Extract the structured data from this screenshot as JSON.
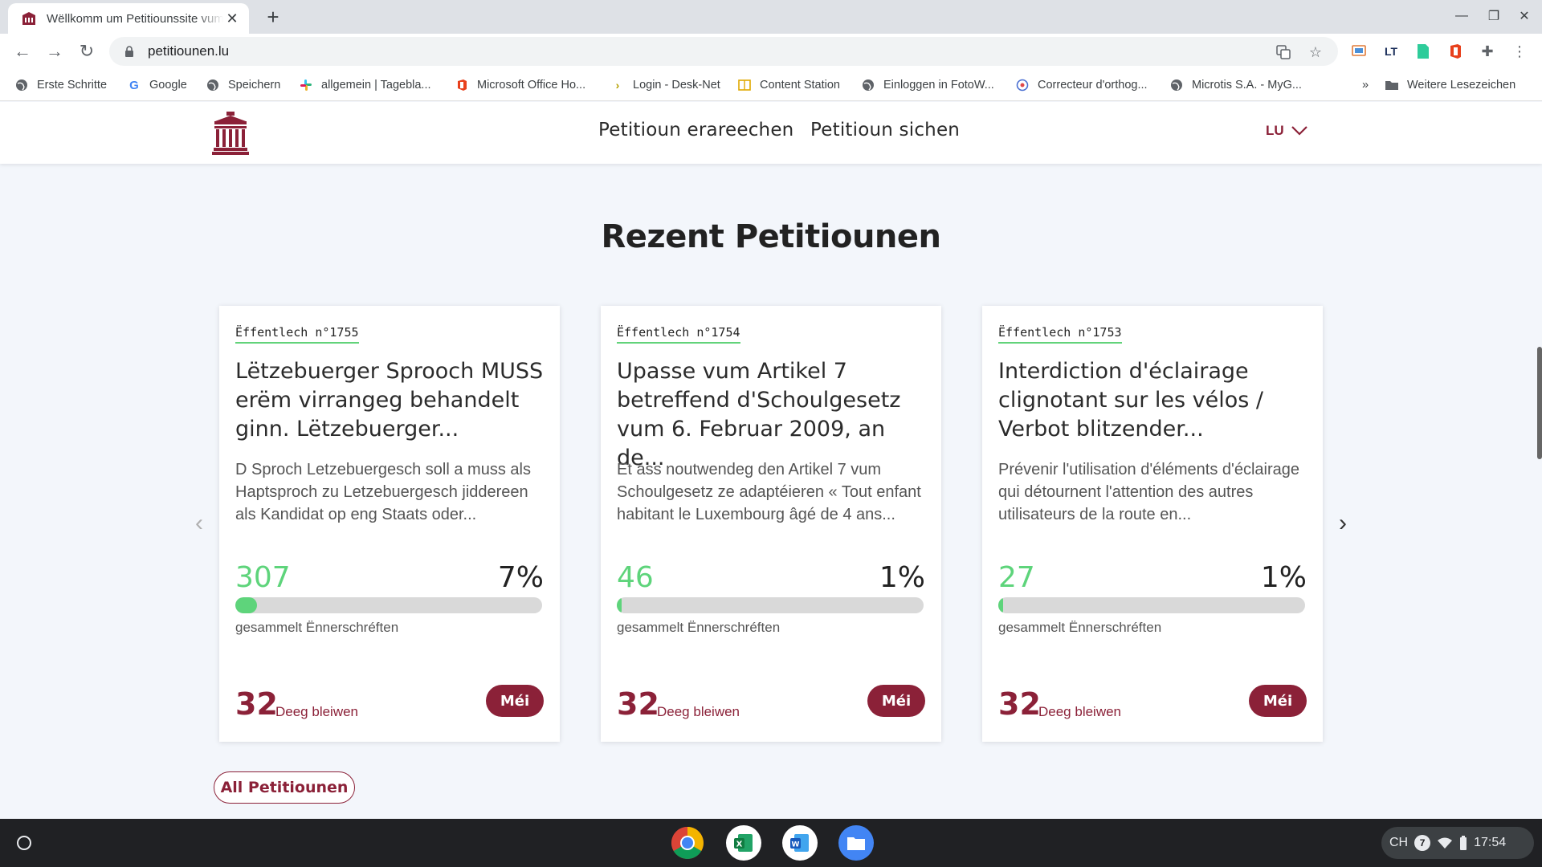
{
  "browser": {
    "tab_title": "Wëllkomm um Petitiounssite vum",
    "url": "petitiounen.lu",
    "bookmarks": [
      {
        "label": "Erste Schritte",
        "icon": "globe-icon"
      },
      {
        "label": "Google",
        "icon": "google-icon"
      },
      {
        "label": "Speichern",
        "icon": "globe-icon"
      },
      {
        "label": "allgemein | Tagebla...",
        "icon": "slack-icon"
      },
      {
        "label": "Microsoft Office Ho...",
        "icon": "office-icon"
      },
      {
        "label": "Login - Desk-Net",
        "icon": "desknet-icon"
      },
      {
        "label": "Content Station",
        "icon": "book-icon"
      },
      {
        "label": "Einloggen in FotoW...",
        "icon": "globe-icon"
      },
      {
        "label": "Correcteur d'orthog...",
        "icon": "spellcheck-icon"
      },
      {
        "label": "Microtis S.A. - MyG...",
        "icon": "globe-icon"
      }
    ],
    "more_bookmarks": "»",
    "other_bookmarks": "Weitere Lesezeichen"
  },
  "site": {
    "nav": [
      "Petitioun erareechen",
      "Petitioun sichen"
    ],
    "lang": "LU",
    "section_title": "Rezent Petitiounen",
    "all_button": "All Petitiounen"
  },
  "cards": [
    {
      "type": "Ëffentlech n°1755",
      "title": "Lëtzebuerger Sprooch MUSS erëm virrangeg behandelt ginn. Lëtzebuerger...",
      "description": "D Sproch Letzebuergesch soll a muss als Haptsproch zu Letzebuergesch jiddereen als Kandidat op eng Staats oder...",
      "count": "307",
      "percent": "7%",
      "progress": 0.07,
      "collected_label": "gesammelt Ënnerschréften",
      "days": "32",
      "days_label": "Deeg bleiwen",
      "more": "Méi"
    },
    {
      "type": "Ëffentlech n°1754",
      "title": "Upasse vum Artikel 7 betreffend d'Schoulgesetz vum 6. Februar 2009, an de...",
      "description": "Et ass noutwendeg den Artikel 7 vum Schoulgesetz ze adaptéieren « Tout enfant habitant le Luxembourg âgé de 4 ans...",
      "count": "46",
      "percent": "1%",
      "progress": 0.01,
      "collected_label": "gesammelt Ënnerschréften",
      "days": "32",
      "days_label": "Deeg bleiwen",
      "more": "Méi"
    },
    {
      "type": "Ëffentlech n°1753",
      "title": "Interdiction d'éclairage clignotant sur les vélos / Verbot blitzender...",
      "description": "Prévenir l'utilisation d'éléments d'éclairage qui détournent l'attention des autres utilisateurs de la route en...",
      "count": "27",
      "percent": "1%",
      "progress": 0.01,
      "collected_label": "gesammelt Ënnerschréften",
      "days": "32",
      "days_label": "Deeg bleiwen",
      "more": "Méi"
    }
  ],
  "shelf": {
    "apps": [
      "chrome-icon",
      "excel-icon",
      "word-icon",
      "files-icon"
    ],
    "ime": "CH",
    "notifications": "7",
    "time": "17:54"
  },
  "colors": {
    "brand": "#8b2138",
    "green": "#5ed47b"
  }
}
